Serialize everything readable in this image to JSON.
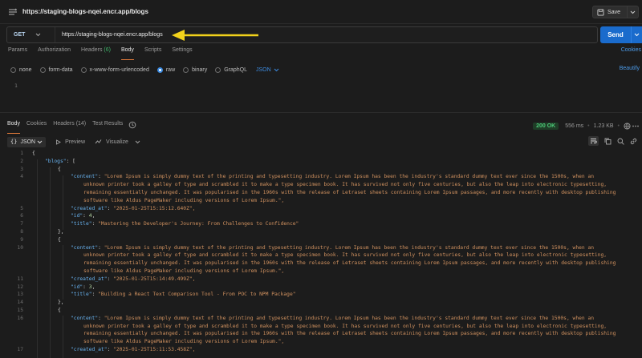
{
  "title": "https://staging-blogs-nqei.encr.app/blogs",
  "save_label": "Save",
  "request": {
    "method": "GET",
    "url": "https://staging-blogs-nqei.encr.app/blogs",
    "send_label": "Send"
  },
  "request_tabs": [
    {
      "label": "Params"
    },
    {
      "label": "Authorization"
    },
    {
      "label": "Headers",
      "count": "(6)"
    },
    {
      "label": "Body"
    },
    {
      "label": "Scripts"
    },
    {
      "label": "Settings"
    }
  ],
  "cookies_label": "Cookies",
  "body_types": [
    "none",
    "form-data",
    "x-www-form-urlencoded",
    "raw",
    "binary",
    "GraphQL"
  ],
  "body_selected": "raw",
  "body_format": "JSON",
  "beautify_label": "Beautify",
  "request_editor_line": "1",
  "response_tabs": [
    {
      "label": "Body"
    },
    {
      "label": "Cookies"
    },
    {
      "label": "Headers",
      "count": "(14)"
    },
    {
      "label": "Test Results"
    }
  ],
  "response_status": {
    "status": "200 OK",
    "time": "556 ms",
    "size": "1.23 KB"
  },
  "response_toolbar": {
    "format": "JSON",
    "preview": "Preview",
    "visualize": "Visualize"
  },
  "colors": {
    "accent": "#1a6bcc",
    "status_ok": "#4cc777",
    "json_key": "#68b2ef",
    "json_string": "#d0915f",
    "json_number": "#b6d9a5",
    "arrow": "#f2d21b"
  },
  "response_lines": [
    {
      "num": "1",
      "text": "{"
    },
    {
      "num": "2",
      "key": "blogs",
      "punct": ": ["
    },
    {
      "num": "3",
      "text": "{"
    },
    {
      "num": "4",
      "key": "content",
      "punct": ": ",
      "value": "\"Lorem Ipsum is simply dummy text of the printing and typesetting industry. Lorem Ipsum has been the industry's standard dummy text ever since the 1500s, when an"
    },
    {
      "num": "",
      "value": "unknown printer took a galley of type and scrambled it to make a type specimen book. It has survived not only five centuries, but also the leap into electronic typesetting,"
    },
    {
      "num": "",
      "value": "remaining essentially unchanged. It was popularised in the 1960s with the release of Letraset sheets containing Lorem Ipsum passages, and more recently with desktop publishing"
    },
    {
      "num": "",
      "value": "software like Aldus PageMaker including versions of Lorem Ipsum.\","
    },
    {
      "num": "5",
      "key": "created_at",
      "punct": ": ",
      "value": "\"2025-01-25T15:15:12.640Z\","
    },
    {
      "num": "6",
      "key": "id",
      "punct": ": ",
      "number": "4",
      "tail": ","
    },
    {
      "num": "7",
      "key": "title",
      "punct": ": ",
      "value": "\"Mastering the Developer's Journey: From Challenges to Confidence\""
    },
    {
      "num": "8",
      "text": "},"
    },
    {
      "num": "9",
      "text": "{"
    },
    {
      "num": "10",
      "key": "content",
      "punct": ": ",
      "value": "\"Lorem Ipsum is simply dummy text of the printing and typesetting industry. Lorem Ipsum has been the industry's standard dummy text ever since the 1500s, when an"
    },
    {
      "num": "",
      "value": "unknown printer took a galley of type and scrambled it to make a type specimen book. It has survived not only five centuries, but also the leap into electronic typesetting,"
    },
    {
      "num": "",
      "value": "remaining essentially unchanged. It was popularised in the 1960s with the release of Letraset sheets containing Lorem Ipsum passages, and more recently with desktop publishing"
    },
    {
      "num": "",
      "value": "software like Aldus PageMaker including versions of Lorem Ipsum.\","
    },
    {
      "num": "11",
      "key": "created_at",
      "punct": ": ",
      "value": "\"2025-01-25T15:14:49.499Z\","
    },
    {
      "num": "12",
      "key": "id",
      "punct": ": ",
      "number": "3",
      "tail": ","
    },
    {
      "num": "13",
      "key": "title",
      "punct": ": ",
      "value": "\"Building a React Text Comparison Tool - From POC to NPM Package\""
    },
    {
      "num": "14",
      "text": "},"
    },
    {
      "num": "15",
      "text": "{"
    },
    {
      "num": "16",
      "key": "content",
      "punct": ": ",
      "value": "\"Lorem Ipsum is simply dummy text of the printing and typesetting industry. Lorem Ipsum has been the industry's standard dummy text ever since the 1500s, when an"
    },
    {
      "num": "",
      "value": "unknown printer took a galley of type and scrambled it to make a type specimen book. It has survived not only five centuries, but also the leap into electronic typesetting,"
    },
    {
      "num": "",
      "value": "remaining essentially unchanged. It was popularised in the 1960s with the release of Letraset sheets containing Lorem Ipsum passages, and more recently with desktop publishing"
    },
    {
      "num": "",
      "value": "software like Aldus PageMaker including versions of Lorem Ipsum.\","
    },
    {
      "num": "17",
      "key": "created_at",
      "punct": ": ",
      "value": "\"2025-01-25T15:11:53.458Z\","
    }
  ]
}
